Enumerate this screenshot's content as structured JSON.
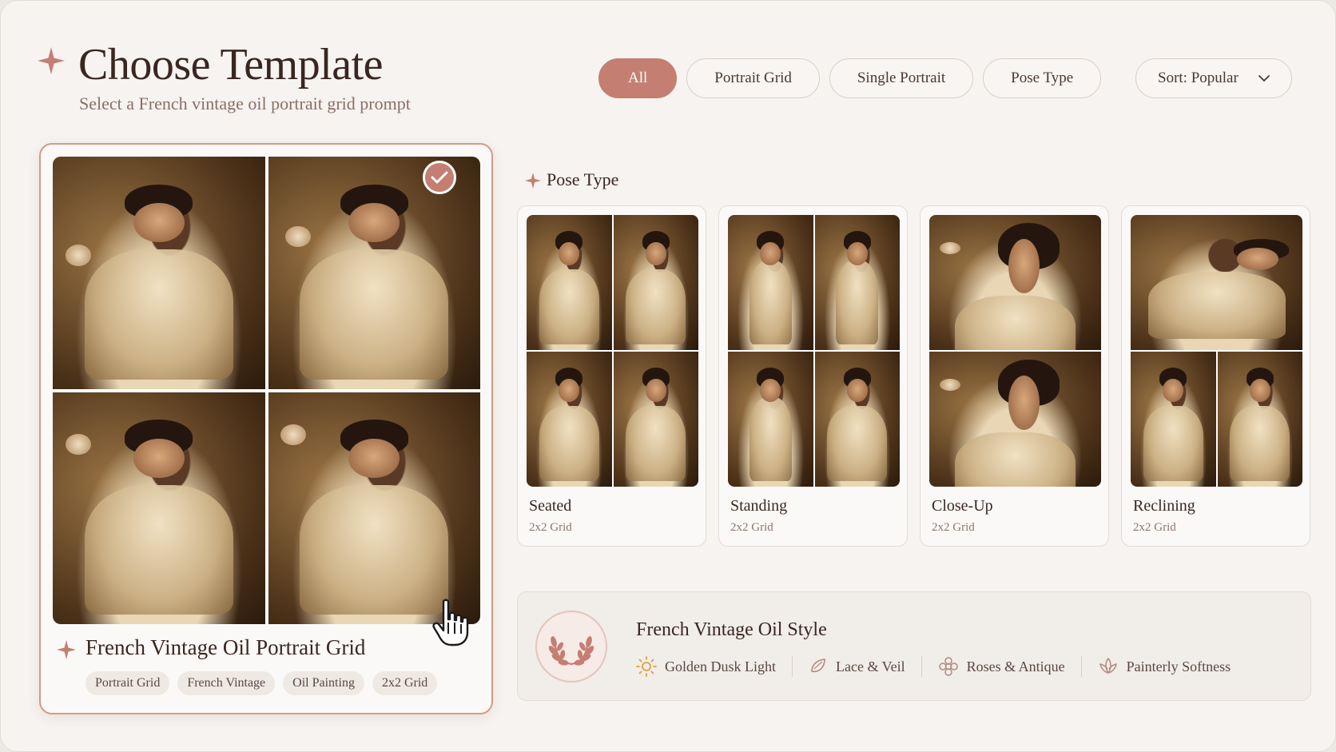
{
  "header": {
    "title": "Choose Template",
    "subtitle": "Select a French vintage oil portrait grid prompt"
  },
  "filters": [
    {
      "label": "All",
      "active": true
    },
    {
      "label": "Portrait Grid",
      "active": false
    },
    {
      "label": "Single Portrait",
      "active": false
    },
    {
      "label": "Pose Type",
      "active": false
    }
  ],
  "sort": {
    "label": "Sort: Popular"
  },
  "selected_template": {
    "title": "French Vintage Oil Portrait Grid",
    "tags": [
      "Portrait Grid",
      "French Vintage",
      "Oil Painting",
      "2x2 Grid"
    ],
    "selected": true
  },
  "pose_section": {
    "title": "Pose Type",
    "cards": [
      {
        "name": "Seated",
        "sub": "2x2 Grid"
      },
      {
        "name": "Standing",
        "sub": "2x2 Grid"
      },
      {
        "name": "Close-Up",
        "sub": "2x2 Grid"
      },
      {
        "name": "Reclining",
        "sub": "2x2 Grid"
      }
    ]
  },
  "style_panel": {
    "title": "French Vintage Oil Style",
    "features": [
      {
        "label": "Golden Dusk Light",
        "icon": "sun-icon"
      },
      {
        "label": "Lace & Veil",
        "icon": "lace-icon"
      },
      {
        "label": "Roses & Antique",
        "icon": "rose-icon"
      },
      {
        "label": "Painterly Softness",
        "icon": "lotus-icon"
      }
    ]
  },
  "colors": {
    "accent": "#c47f72",
    "background": "#f6f3f0",
    "text": "#3a2620"
  }
}
